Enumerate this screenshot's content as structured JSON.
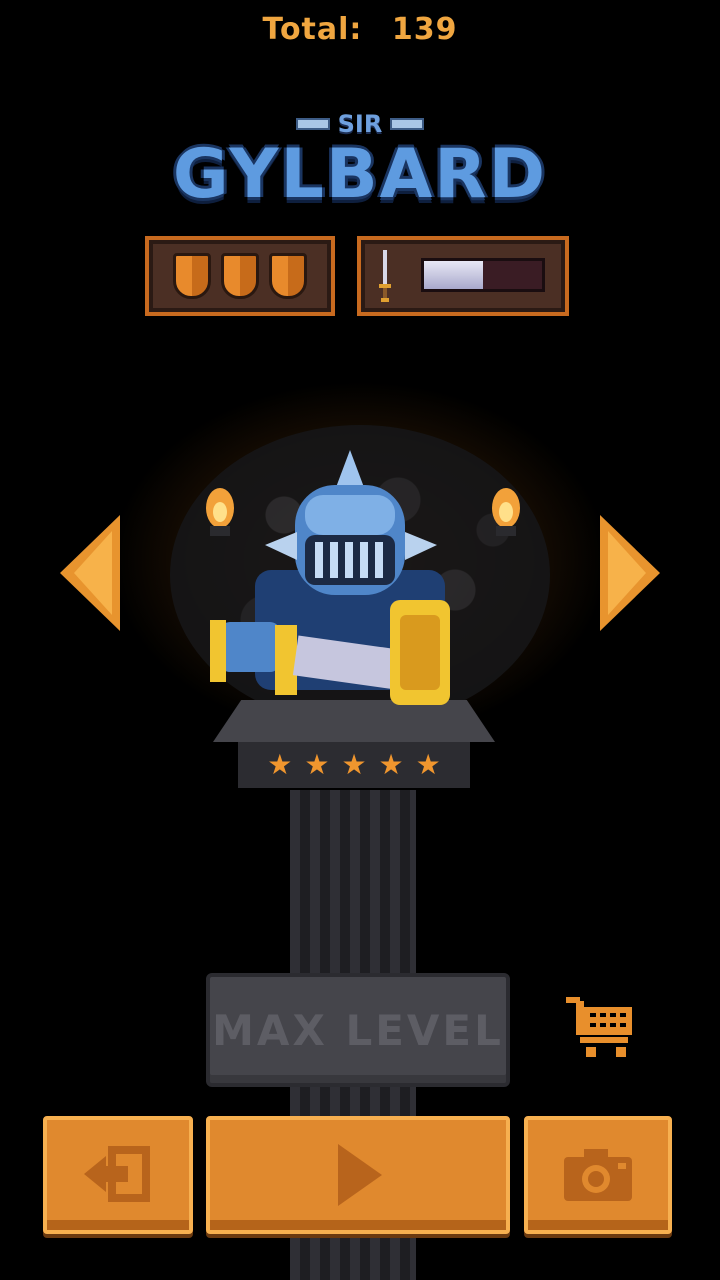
{
  "header": {
    "total_label": "Total:",
    "total_value": "139"
  },
  "character": {
    "title_prefix": "SIR",
    "name": "GYLBARD",
    "shield_count": 3,
    "sword_power_fraction": 0.5,
    "stars": [
      "★",
      "★",
      "★",
      "★",
      "★"
    ]
  },
  "upgrade": {
    "label": "MAX LEVEL"
  },
  "nav": {
    "prev_icon": "left-arrow-icon",
    "next_icon": "right-arrow-icon"
  },
  "actions": {
    "exit_icon": "exit-icon",
    "play_icon": "play-icon",
    "camera_icon": "camera-icon",
    "shop_icon": "cart-icon"
  },
  "colors": {
    "accent": "#e0892e",
    "title_blue": "#5e9be0",
    "background": "#000000"
  }
}
